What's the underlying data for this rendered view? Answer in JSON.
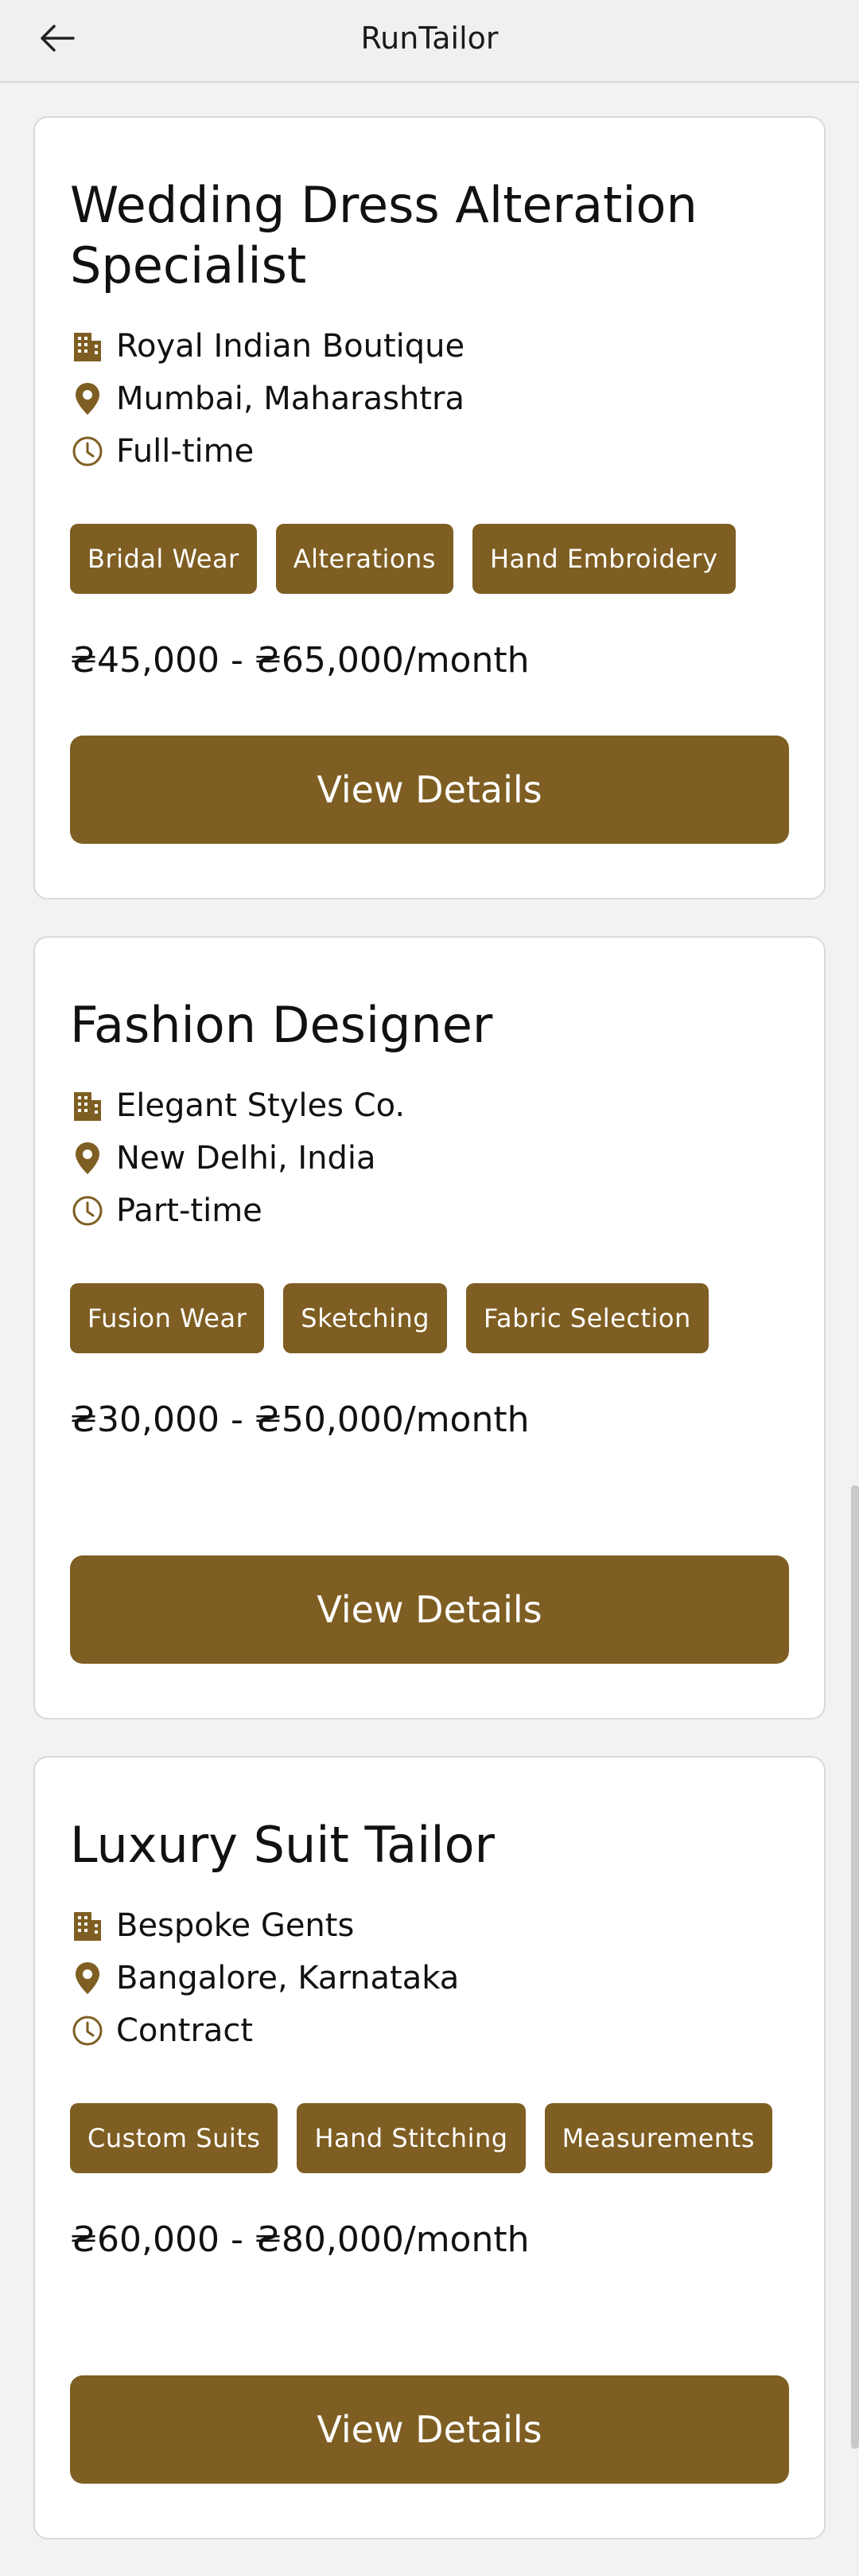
{
  "app_bar": {
    "title": "RunTailor",
    "back_icon": "arrow-left-icon"
  },
  "accent_color": "#7e5e22",
  "jobs": [
    {
      "title": "Wedding Dress Alteration Specialist",
      "company": "Royal Indian Boutique",
      "location": "Mumbai, Maharashtra",
      "type": "Full-time",
      "tags": [
        "Bridal Wear",
        "Alterations",
        "Hand Embroidery"
      ],
      "salary": "₴45,000 - ₴65,000/month",
      "button_label": "View Details"
    },
    {
      "title": "Fashion Designer",
      "company": "Elegant Styles Co.",
      "location": "New Delhi, India",
      "type": "Part-time",
      "tags": [
        "Fusion Wear",
        "Sketching",
        "Fabric Selection"
      ],
      "salary": "₴30,000 - ₴50,000/month",
      "button_label": "View Details"
    },
    {
      "title": "Luxury Suit Tailor",
      "company": "Bespoke Gents",
      "location": "Bangalore, Karnataka",
      "type": "Contract",
      "tags": [
        "Custom Suits",
        "Hand Stitching",
        "Measurements"
      ],
      "salary": "₴60,000 - ₴80,000/month",
      "button_label": "View Details"
    }
  ]
}
